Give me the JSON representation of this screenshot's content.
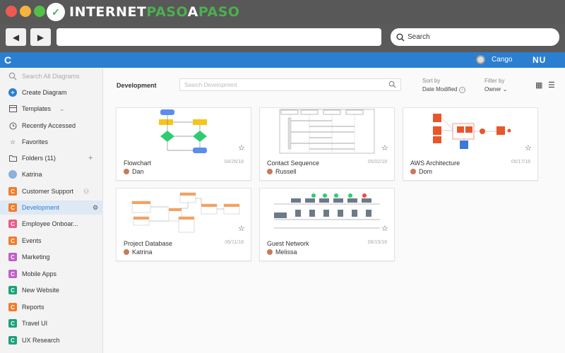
{
  "browser": {
    "back_glyph": "◀",
    "forward_glyph": "▶",
    "search_label": "Search",
    "watermark": {
      "prefix": "INTERNET",
      "accent1": "PASO",
      "middle": "A",
      "accent2": "PASO"
    }
  },
  "app": {
    "logo_glyph": "C",
    "user_name": "Cango",
    "brand": "NU",
    "accent_color": "#2b7fd1"
  },
  "sidebar": {
    "search_placeholder": "Search All Diagrams",
    "actions": [
      {
        "label": "Create Diagram",
        "icon": "plus-circle-icon"
      },
      {
        "label": "Templates",
        "icon": "templates-icon"
      },
      {
        "label": "Recently Accessed",
        "icon": "clock-icon"
      },
      {
        "label": "Favorites",
        "icon": "star-icon"
      },
      {
        "label": "Folders (11)",
        "icon": "folder-icon"
      },
      {
        "label": "Katrina",
        "icon": "user-avatar-icon"
      }
    ],
    "folders": [
      {
        "label": "Customer Support",
        "color": "#f07d28"
      },
      {
        "label": "Development",
        "color": "#f07d28"
      },
      {
        "label": "Employee Onboar...",
        "color": "#e85d8a"
      },
      {
        "label": "Events",
        "color": "#f07d28"
      },
      {
        "label": "Marketing",
        "color": "#c05fc8"
      },
      {
        "label": "Mobile Apps",
        "color": "#c05fc8"
      },
      {
        "label": "New Website",
        "color": "#1aa27a"
      },
      {
        "label": "Reports",
        "color": "#f07d28"
      },
      {
        "label": "Travel UI",
        "color": "#1aa27a"
      },
      {
        "label": "UX Research",
        "color": "#1aa27a"
      }
    ]
  },
  "main": {
    "title": "Development",
    "search_placeholder": "Search Development",
    "sort_label": "Sort by",
    "sort_value": "Date Modified",
    "filter_label": "Filter by",
    "filter_value": "Owner",
    "cards": [
      {
        "name": "Flowchart",
        "date": "04/26/18",
        "user": "Dan"
      },
      {
        "name": "Contact Sequence",
        "date": "05/02/18",
        "user": "Russell"
      },
      {
        "name": "AWS Architecture",
        "date": "05/17/18",
        "user": "Dom"
      },
      {
        "name": "Project Database",
        "date": "06/11/18",
        "user": "Katrina"
      },
      {
        "name": "Guest Network",
        "date": "06/15/18",
        "user": "Melissa"
      }
    ]
  }
}
